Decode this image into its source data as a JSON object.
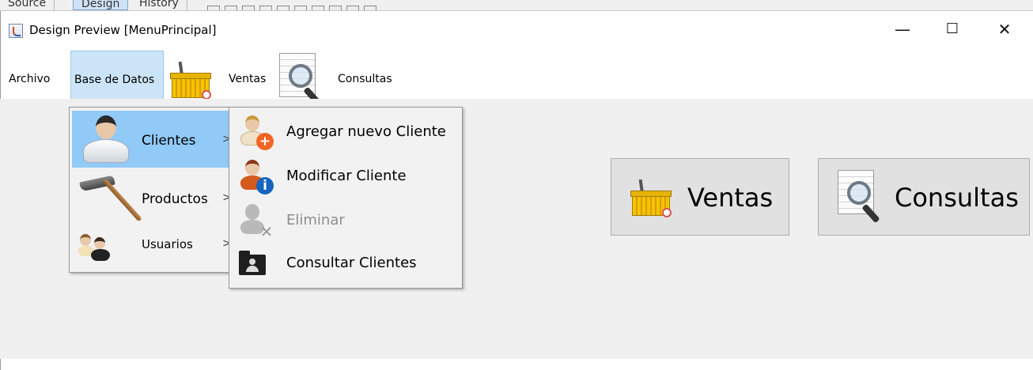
{
  "ide": {
    "tabs": [
      "Source",
      "Design",
      "History"
    ]
  },
  "window": {
    "title": "Design Preview [MenuPrincipal]",
    "minimize_glyph": "—",
    "maximize_glyph": "☐",
    "close_glyph": "✕"
  },
  "menubar": {
    "items": [
      {
        "label": "Archivo",
        "icon": null
      },
      {
        "label": "Base de Datos",
        "icon": null,
        "selected": true
      },
      {
        "label": "Ventas",
        "icon": "basket-icon"
      },
      {
        "label": "Consultas",
        "icon": "document-search-icon"
      }
    ]
  },
  "submenu_base_datos": {
    "items": [
      {
        "label": "Clientes",
        "icon": "client-person-icon",
        "has_submenu": true,
        "highlighted": true
      },
      {
        "label": "Productos",
        "icon": "hammer-icon",
        "has_submenu": true
      },
      {
        "label": "Usuarios",
        "icon": "users-icon",
        "has_submenu": true
      }
    ],
    "arrow_glyph": ">"
  },
  "submenu_clientes": {
    "items": [
      {
        "label": "Agregar nuevo Cliente",
        "icon": "user-add-icon",
        "enabled": true
      },
      {
        "label": "Modificar Cliente",
        "icon": "user-info-icon",
        "enabled": true
      },
      {
        "label": "Eliminar",
        "icon": "user-remove-icon",
        "enabled": false
      },
      {
        "label": "Consultar Clientes",
        "icon": "user-folder-icon",
        "enabled": true
      }
    ]
  },
  "buttons": {
    "ventas": "Ventas",
    "consultas": "Consultas"
  },
  "colors": {
    "menu_selected_bg": "#cce4f7",
    "menu_highlight_bg": "#91c9f7",
    "disabled_text": "#8d8d8d",
    "add_badge": "#f26522",
    "info_badge": "#1565c0"
  }
}
